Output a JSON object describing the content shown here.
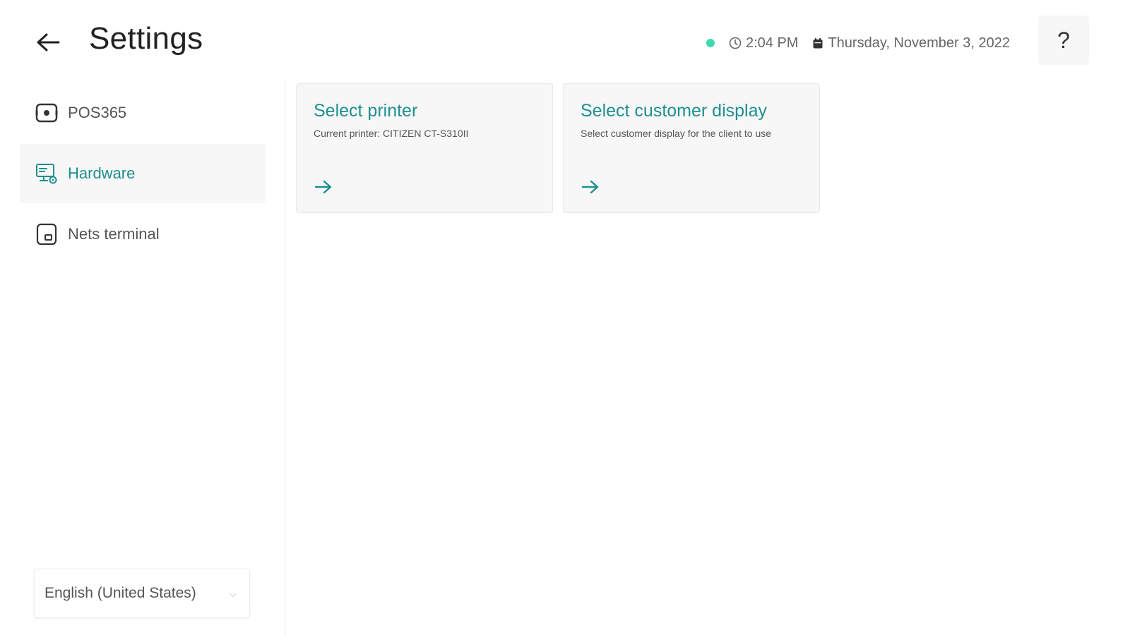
{
  "header": {
    "title": "Settings",
    "back_icon": "arrow-left-icon",
    "status": {
      "online_color": "#3ddbb0",
      "time": "2:04 PM",
      "date": "Thursday, November 3, 2022"
    },
    "help_label": "?"
  },
  "sidebar": {
    "items": [
      {
        "label": "POS365",
        "icon": "pos-device-icon",
        "active": false
      },
      {
        "label": "Hardware",
        "icon": "hardware-monitor-icon",
        "active": true
      },
      {
        "label": "Nets terminal",
        "icon": "terminal-icon",
        "active": false
      }
    ],
    "language": {
      "selected": "English (United States)"
    }
  },
  "cards": [
    {
      "title": "Select printer",
      "subtitle": "Current printer: CITIZEN CT-S310II"
    },
    {
      "title": "Select customer display",
      "subtitle": "Select customer display for the client to use"
    }
  ],
  "colors": {
    "accent": "#1f8f8f",
    "active_bg": "#f7f7f7",
    "card_bg": "#f7f7f7"
  }
}
